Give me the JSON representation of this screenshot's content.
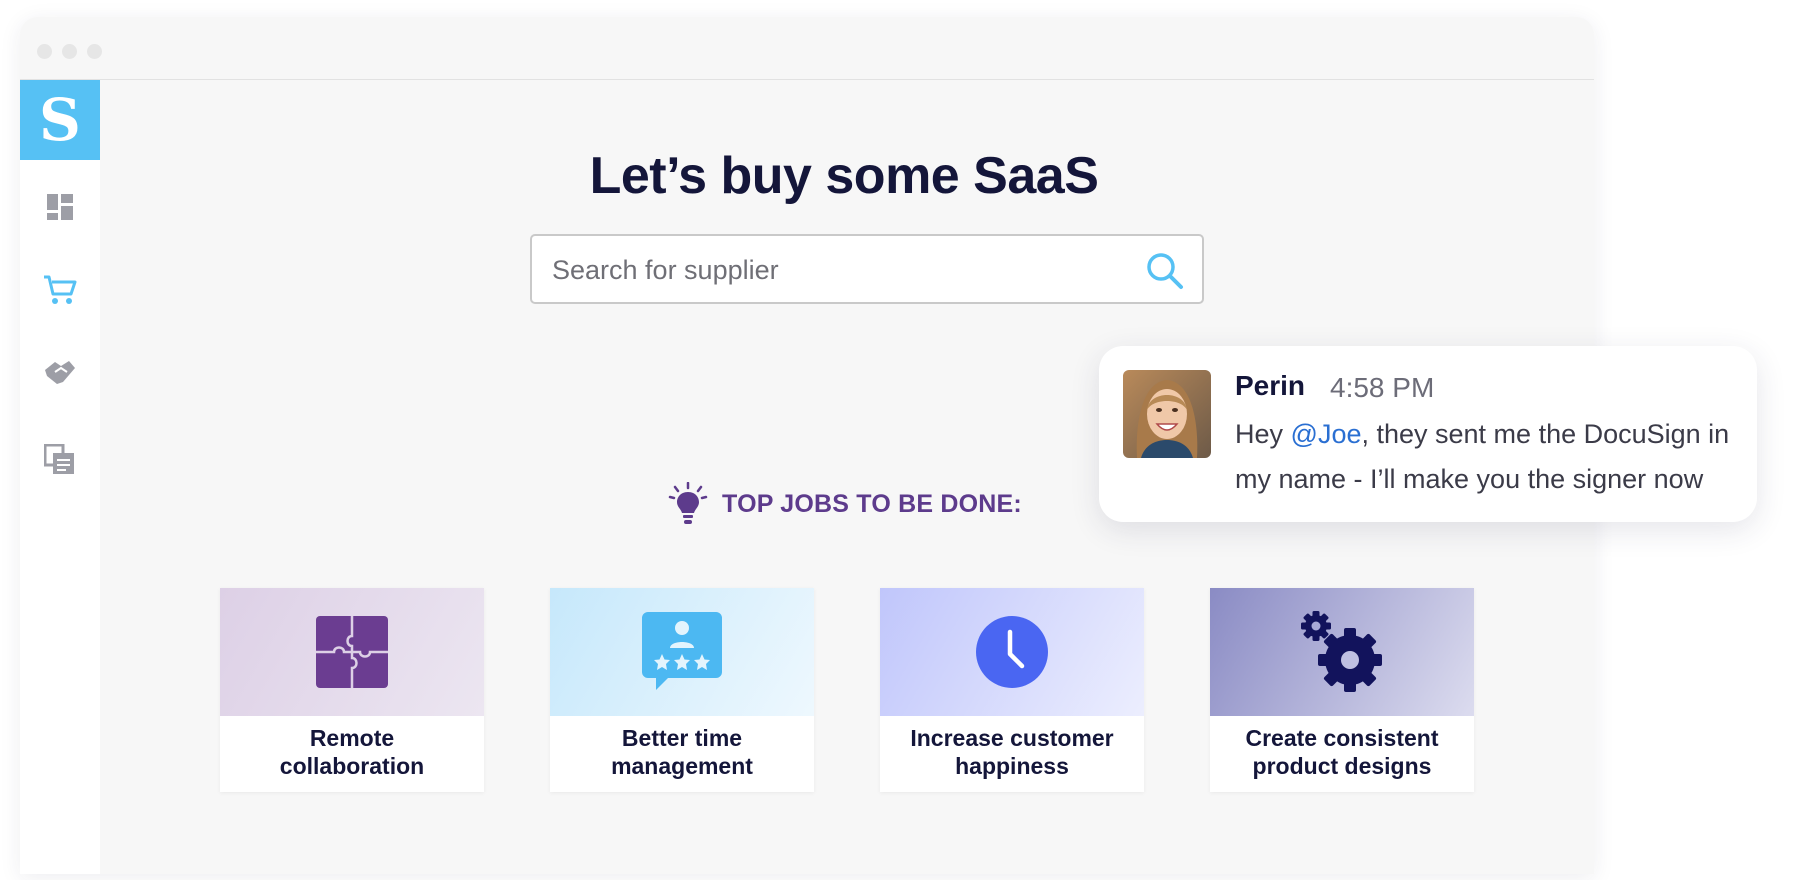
{
  "app": {
    "logo_letter": "S"
  },
  "sidebar": {
    "items": [
      {
        "name": "dashboard",
        "icon": "dashboard-icon"
      },
      {
        "name": "buy",
        "icon": "cart-icon",
        "active": true
      },
      {
        "name": "deals",
        "icon": "handshake-icon"
      },
      {
        "name": "documents",
        "icon": "documents-icon"
      }
    ],
    "active_color": "#56c1f4",
    "inactive_color": "#9d9ea6"
  },
  "main": {
    "title": "Let’s buy some SaaS",
    "search": {
      "placeholder": "Search for supplier",
      "value": ""
    },
    "jobs": {
      "heading": "TOP JOBS TO BE DONE:",
      "cards": [
        {
          "label_line1": "Remote",
          "label_line2": "collaboration",
          "icon": "puzzle-icon"
        },
        {
          "label_line1": "Better time",
          "label_line2": "management",
          "icon": "rating-bubble-icon"
        },
        {
          "label_line1": "Increase customer",
          "label_line2": "happiness",
          "icon": "clock-icon"
        },
        {
          "label_line1": "Create consistent",
          "label_line2": "product designs",
          "icon": "gears-icon"
        }
      ]
    }
  },
  "chat": {
    "name": "Perin",
    "time": "4:58 PM",
    "message_prefix": "Hey ",
    "mention": "@Joe",
    "message_suffix": ", they sent me the DocuSign in my name - I’ll make you the signer now"
  },
  "colors": {
    "title": "#14163a",
    "accent": "#56c1f4",
    "jobs_heading": "#5d3b8c",
    "mention": "#2a6fd2"
  }
}
